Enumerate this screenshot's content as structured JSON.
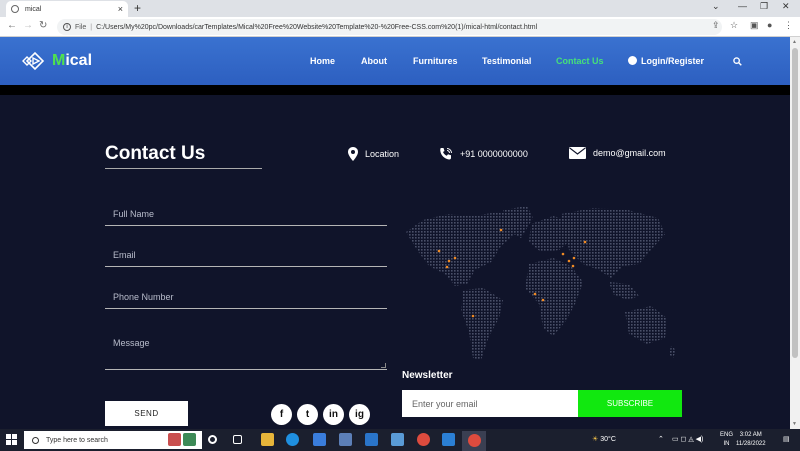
{
  "browser": {
    "tab_title": "mical",
    "tab_close": "×",
    "new_tab": "+",
    "address_prefix": "File",
    "address_url": "C:/Users/My%20pc/Downloads/carTemplates/Mical%20Free%20Website%20Template%20-%20Free-CSS.com%20(1)/mical-html/contact.html"
  },
  "header": {
    "logo_first": "M",
    "logo_rest": "ical",
    "nav": [
      {
        "label": "Home"
      },
      {
        "label": "About"
      },
      {
        "label": "Furnitures"
      },
      {
        "label": "Testimonial"
      },
      {
        "label": "Contact Us",
        "active": true
      },
      {
        "label": "Login/Register"
      }
    ],
    "active_color": "#46e07a"
  },
  "contact": {
    "title": "Contact Us",
    "location": "Location",
    "phone": "+91 0000000000",
    "email": "demo@gmail.com",
    "form": {
      "full_name_placeholder": "Full Name",
      "email_placeholder": "Email",
      "phone_placeholder": "Phone Number",
      "message_placeholder": "Message",
      "send_label": "SEND"
    },
    "social": [
      "f",
      "t",
      "in",
      "ig"
    ]
  },
  "newsletter": {
    "title": "Newsletter",
    "email_placeholder": "Enter your email",
    "subscribe_label": "SUBSCRIBE",
    "accent": "#11e80f"
  },
  "taskbar": {
    "search_placeholder": "Type here to search",
    "weather": "30°C",
    "lang_1": "ENG",
    "lang_2": "IN",
    "time": "3:02 AM",
    "date": "11/28/2022"
  }
}
